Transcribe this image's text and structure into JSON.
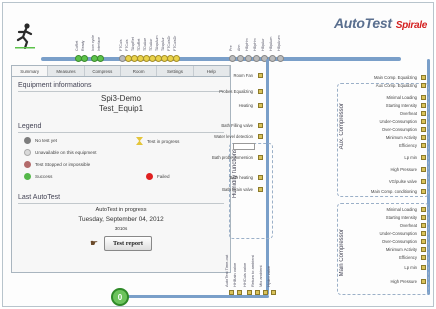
{
  "brand": {
    "title": "AutoTest",
    "logo": "Spirale"
  },
  "top_labels": [
    "CoRet",
    "Ready",
    "Icon cycle",
    "Interface",
    "FTCuis",
    "FTCuis",
    "TAspRet",
    "TDuRet",
    "TDuAue",
    "TDuAur",
    "TAspAum",
    "TAspAur",
    "FTCuisDr",
    "FTCuisDr",
    "Pre",
    "Ahn",
    "HBpHm",
    "HBpHm",
    "HBpAur",
    "HBpAum",
    "HBpArum"
  ],
  "tabs": [
    "Summary",
    "Measures",
    "Compress",
    "Room",
    "Settings",
    "Help"
  ],
  "equipment": {
    "title": "Equipment informations",
    "name": "Spi3-Demo",
    "id": "Test_Equip1"
  },
  "legend": {
    "title": "Legend",
    "items": [
      {
        "label": "No test yet",
        "color": "#7d7d7d"
      },
      {
        "label": "Test in progress",
        "color": "#e4c53a"
      },
      {
        "label": "Unavailable on this equipment",
        "color": "#d9d9d9"
      },
      {
        "label": "Test Stopped or impossible",
        "color": "#b36b6b"
      },
      {
        "label": "Success",
        "color": "#55b84a"
      },
      {
        "label": "Failed",
        "color": "#e02020"
      }
    ]
  },
  "last_autotest": {
    "title": "Last AutoTest",
    "status": "AutoTest in progress",
    "date": "Tuesday, September 04, 2012",
    "code": "3010s",
    "report_button": "Test report"
  },
  "humidity": {
    "title": "Humidity functions",
    "items": [
      "Room Fan",
      "Probes Equalizing",
      "Heating",
      "Bath Filling valve",
      "Water level detection",
      "Duration",
      "Bath probe immersion",
      "Bath heating",
      "Bath Drain valve"
    ]
  },
  "bottom_labels": [
    "AutoTest Time-out",
    "HHBain valve",
    "HHCuis valve",
    "Return to ambient",
    "Mix ambient",
    "Hydro valve"
  ],
  "aux_compressor": {
    "title": "Aux. Compressor",
    "items": [
      "Main Comp. Equalizing",
      "Aux Comp. Equalizing",
      "Minimal Loading",
      "Starting Intensity",
      "Overheat",
      "Under-Consumption",
      "Over-Consumption",
      "Minimum Activity",
      "Efficiency",
      "Lp min",
      "High Pressure",
      "VG/pulse valve"
    ]
  },
  "main_compressor": {
    "title": "Main Compressor",
    "items": [
      "Main Comp. conditioning",
      "Minimal Loading",
      "Starting Intensity",
      "Overheat",
      "Under-Consumption",
      "Over-Consumption",
      "Minimum Activity",
      "Efficiency",
      "Lp min",
      "High Pressure"
    ]
  },
  "counter": "0"
}
